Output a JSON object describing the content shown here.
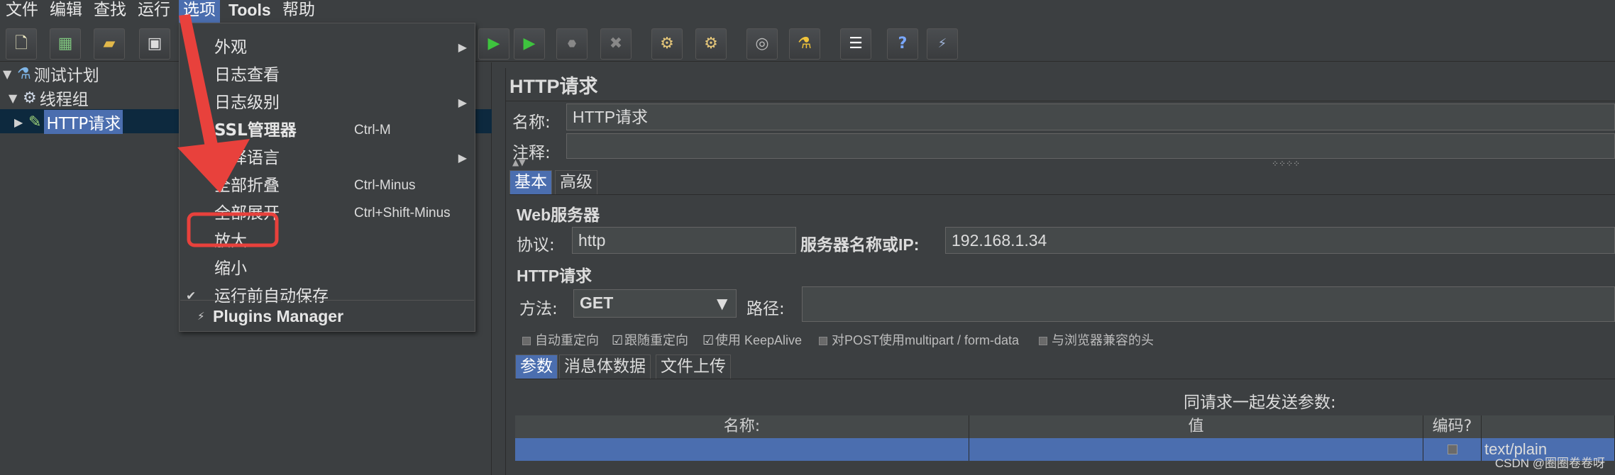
{
  "menubar": {
    "items": [
      {
        "label": "文件"
      },
      {
        "label": "编辑"
      },
      {
        "label": "查找"
      },
      {
        "label": "运行"
      },
      {
        "label": "选项"
      },
      {
        "label": "Tools"
      },
      {
        "label": "帮助"
      }
    ],
    "active": "选项"
  },
  "options_menu": {
    "items": [
      {
        "label": "外观",
        "shortcut": "",
        "submenu": true
      },
      {
        "label": "日志查看",
        "shortcut": ""
      },
      {
        "label": "日志级别",
        "shortcut": "",
        "submenu": true
      },
      {
        "label": "SSL管理器",
        "shortcut": "Ctrl-M"
      },
      {
        "label": "选择语言",
        "shortcut": "",
        "submenu": true
      },
      {
        "label": "全部折叠",
        "shortcut": "Ctrl-Minus"
      },
      {
        "label": "全部展开",
        "shortcut": "Ctrl+Shift-Minus"
      },
      {
        "label": "放大",
        "shortcut": "",
        "highlighted": true
      },
      {
        "label": "缩小",
        "shortcut": ""
      },
      {
        "label": "运行前自动保存",
        "shortcut": "",
        "checked": true
      },
      {
        "label": "Plugins Manager",
        "shortcut": ""
      }
    ]
  },
  "tree": {
    "test_plan": "测试计划",
    "thread_group": "线程组",
    "http_request": "HTTP请求"
  },
  "panel": {
    "title": "HTTP请求",
    "name_label": "名称:",
    "name_value": "HTTP请求",
    "comment_label": "注释:",
    "comment_value": "",
    "tabs": [
      {
        "label": "基本"
      },
      {
        "label": "高级"
      }
    ],
    "web_server_section": "Web服务器",
    "protocol_label": "协议:",
    "protocol_value": "http",
    "server_label": "服务器名称或IP:",
    "server_value": "192.168.1.34",
    "http_request_section": "HTTP请求",
    "method_label": "方法:",
    "method_value": "GET",
    "path_label": "路径:",
    "path_value": "",
    "options": [
      {
        "label": "自动重定向",
        "checked": false
      },
      {
        "label": "跟随重定向",
        "checked": true
      },
      {
        "label": "使用 KeepAlive",
        "checked": true
      },
      {
        "label": "对POST使用multipart / form-data",
        "checked": false
      },
      {
        "label": "与浏览器兼容的头",
        "checked": false
      }
    ],
    "sub_tabs": [
      {
        "label": "参数"
      },
      {
        "label": "消息体数据"
      },
      {
        "label": "文件上传"
      }
    ],
    "send_params_label": "同请求一起发送参数:",
    "table_headers": {
      "name": "名称:",
      "value": "值",
      "encode": "编码?",
      "content_type": ""
    },
    "table_row": {
      "name": "",
      "value": "",
      "content_type": "text/plain"
    }
  },
  "watermark": "CSDN @圈圈卷卷呀",
  "colors": {
    "accent": "#4b6eaf",
    "annotation": "#e8413c",
    "background": "#3c3f41"
  }
}
